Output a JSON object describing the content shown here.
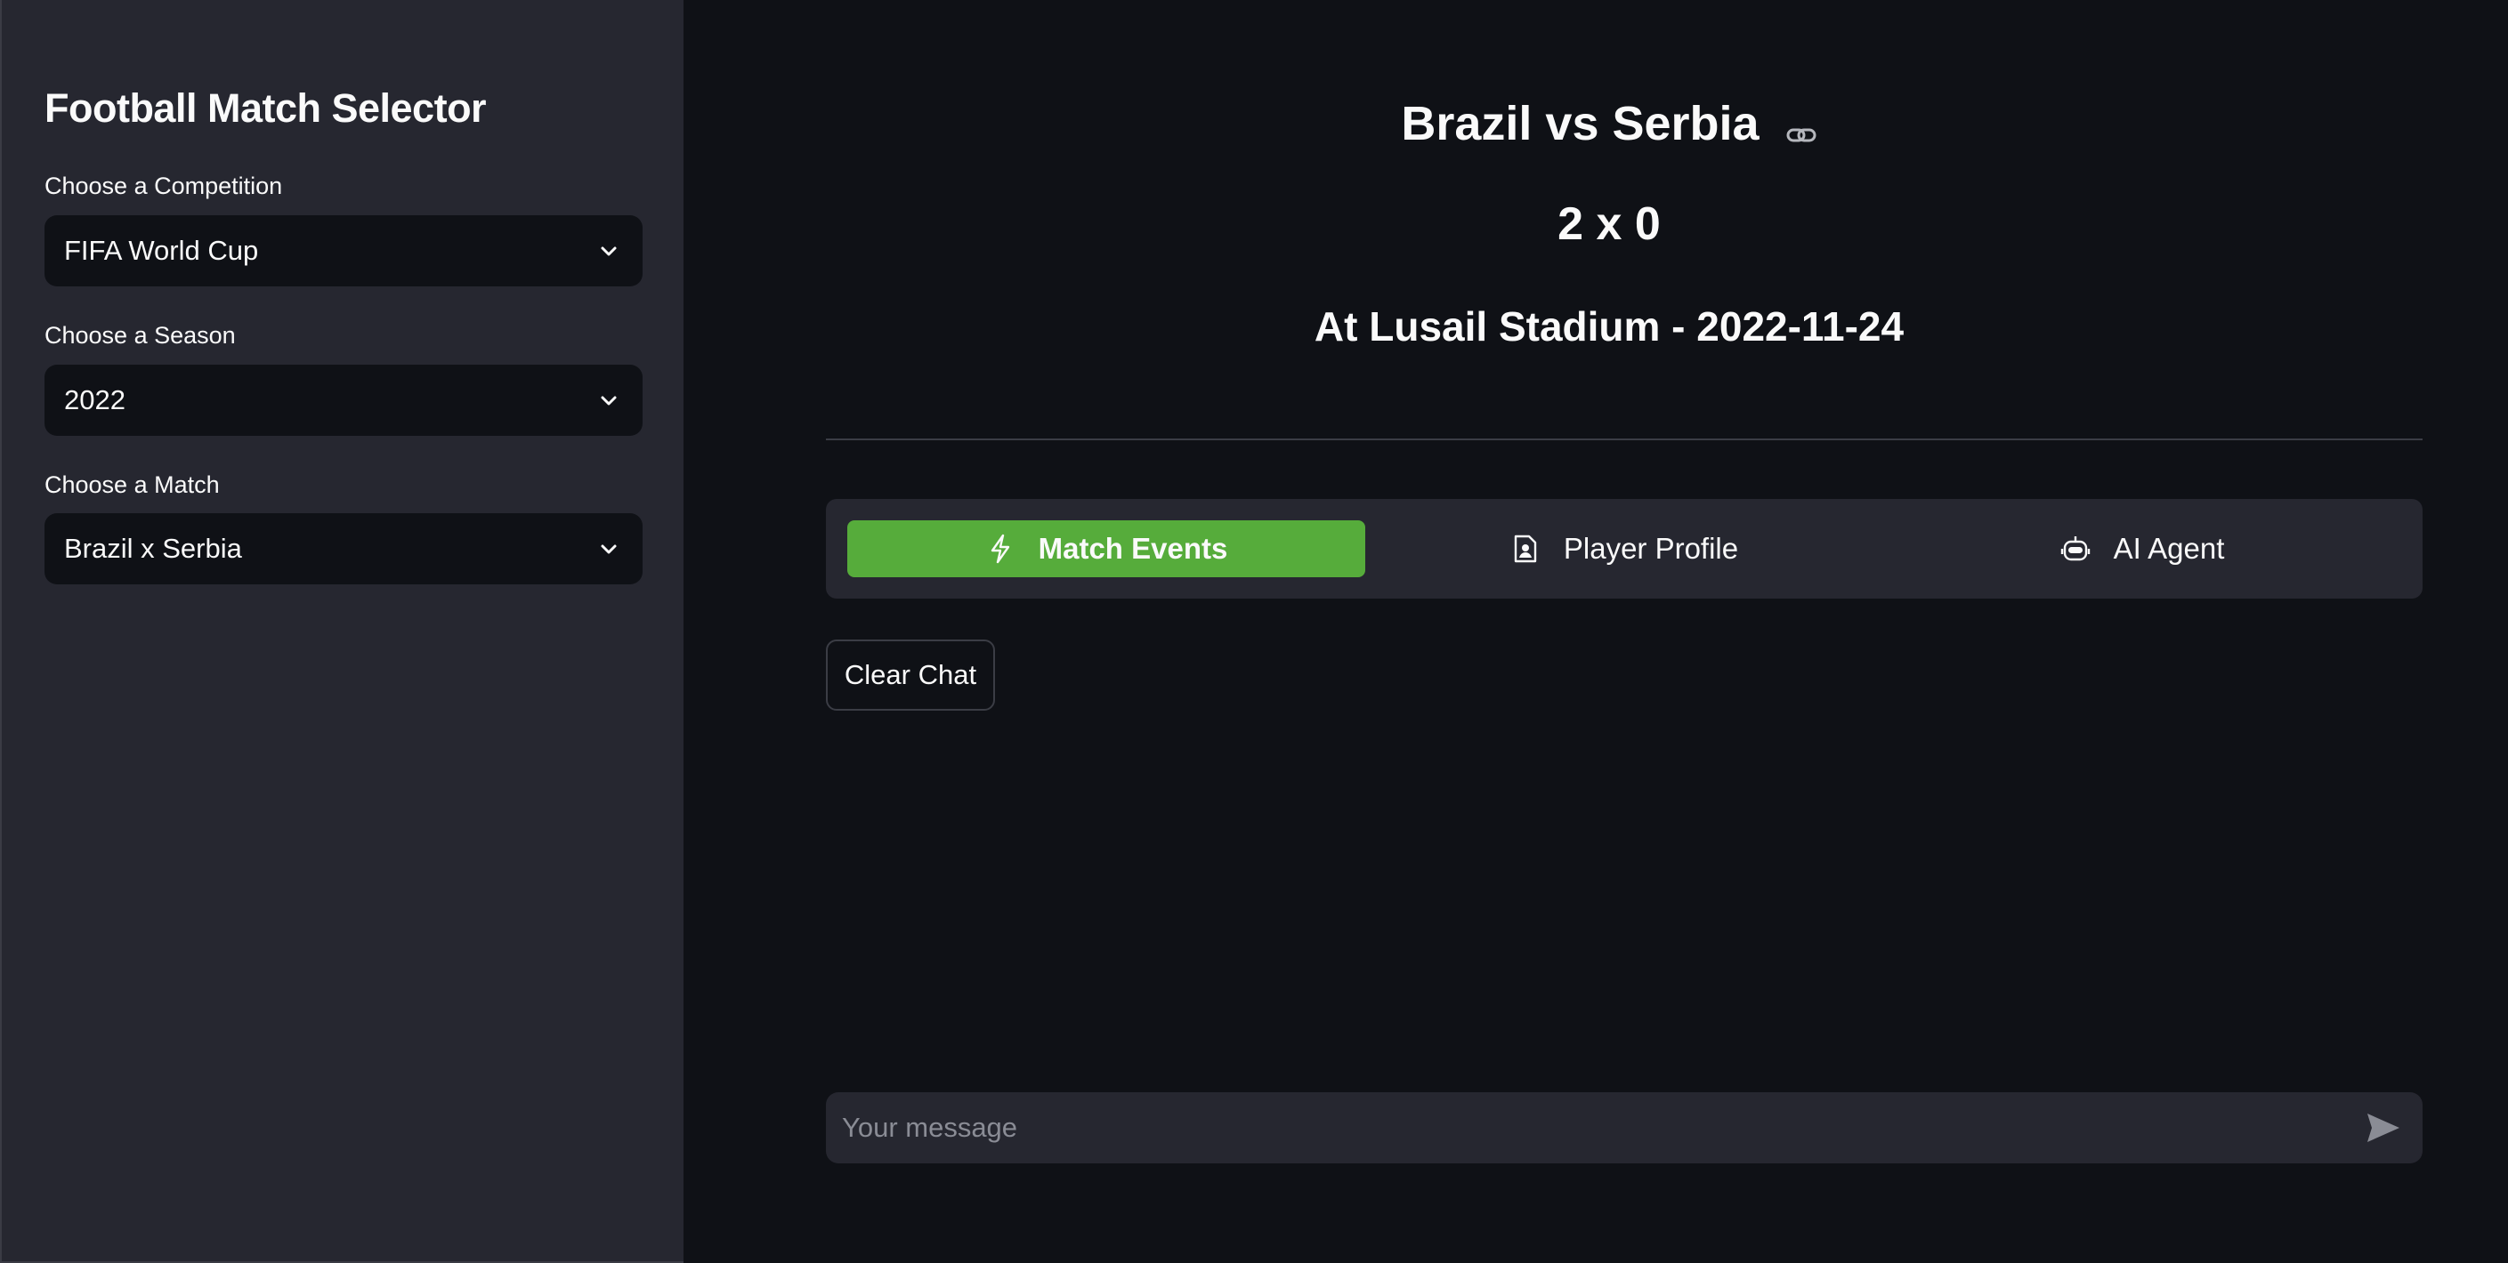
{
  "sidebar": {
    "title": "Football Match Selector",
    "competition": {
      "label": "Choose a Competition",
      "value": "FIFA World Cup"
    },
    "season": {
      "label": "Choose a Season",
      "value": "2022"
    },
    "match": {
      "label": "Choose a Match",
      "value": "Brazil x Serbia"
    }
  },
  "main": {
    "title": "Brazil vs Serbia",
    "score": "2 x 0",
    "venue": "At Lusail Stadium - 2022-11-24",
    "tabs": [
      {
        "label": "Match Events",
        "icon": "lightning-icon",
        "active": true
      },
      {
        "label": "Player Profile",
        "icon": "player-card-icon",
        "active": false
      },
      {
        "label": "AI Agent",
        "icon": "robot-icon",
        "active": false
      }
    ],
    "clear_chat_label": "Clear Chat",
    "chat_placeholder": "Your message"
  },
  "colors": {
    "sidebar_bg": "#262730",
    "main_bg": "#0f1116",
    "accent": "#56ac3b"
  }
}
